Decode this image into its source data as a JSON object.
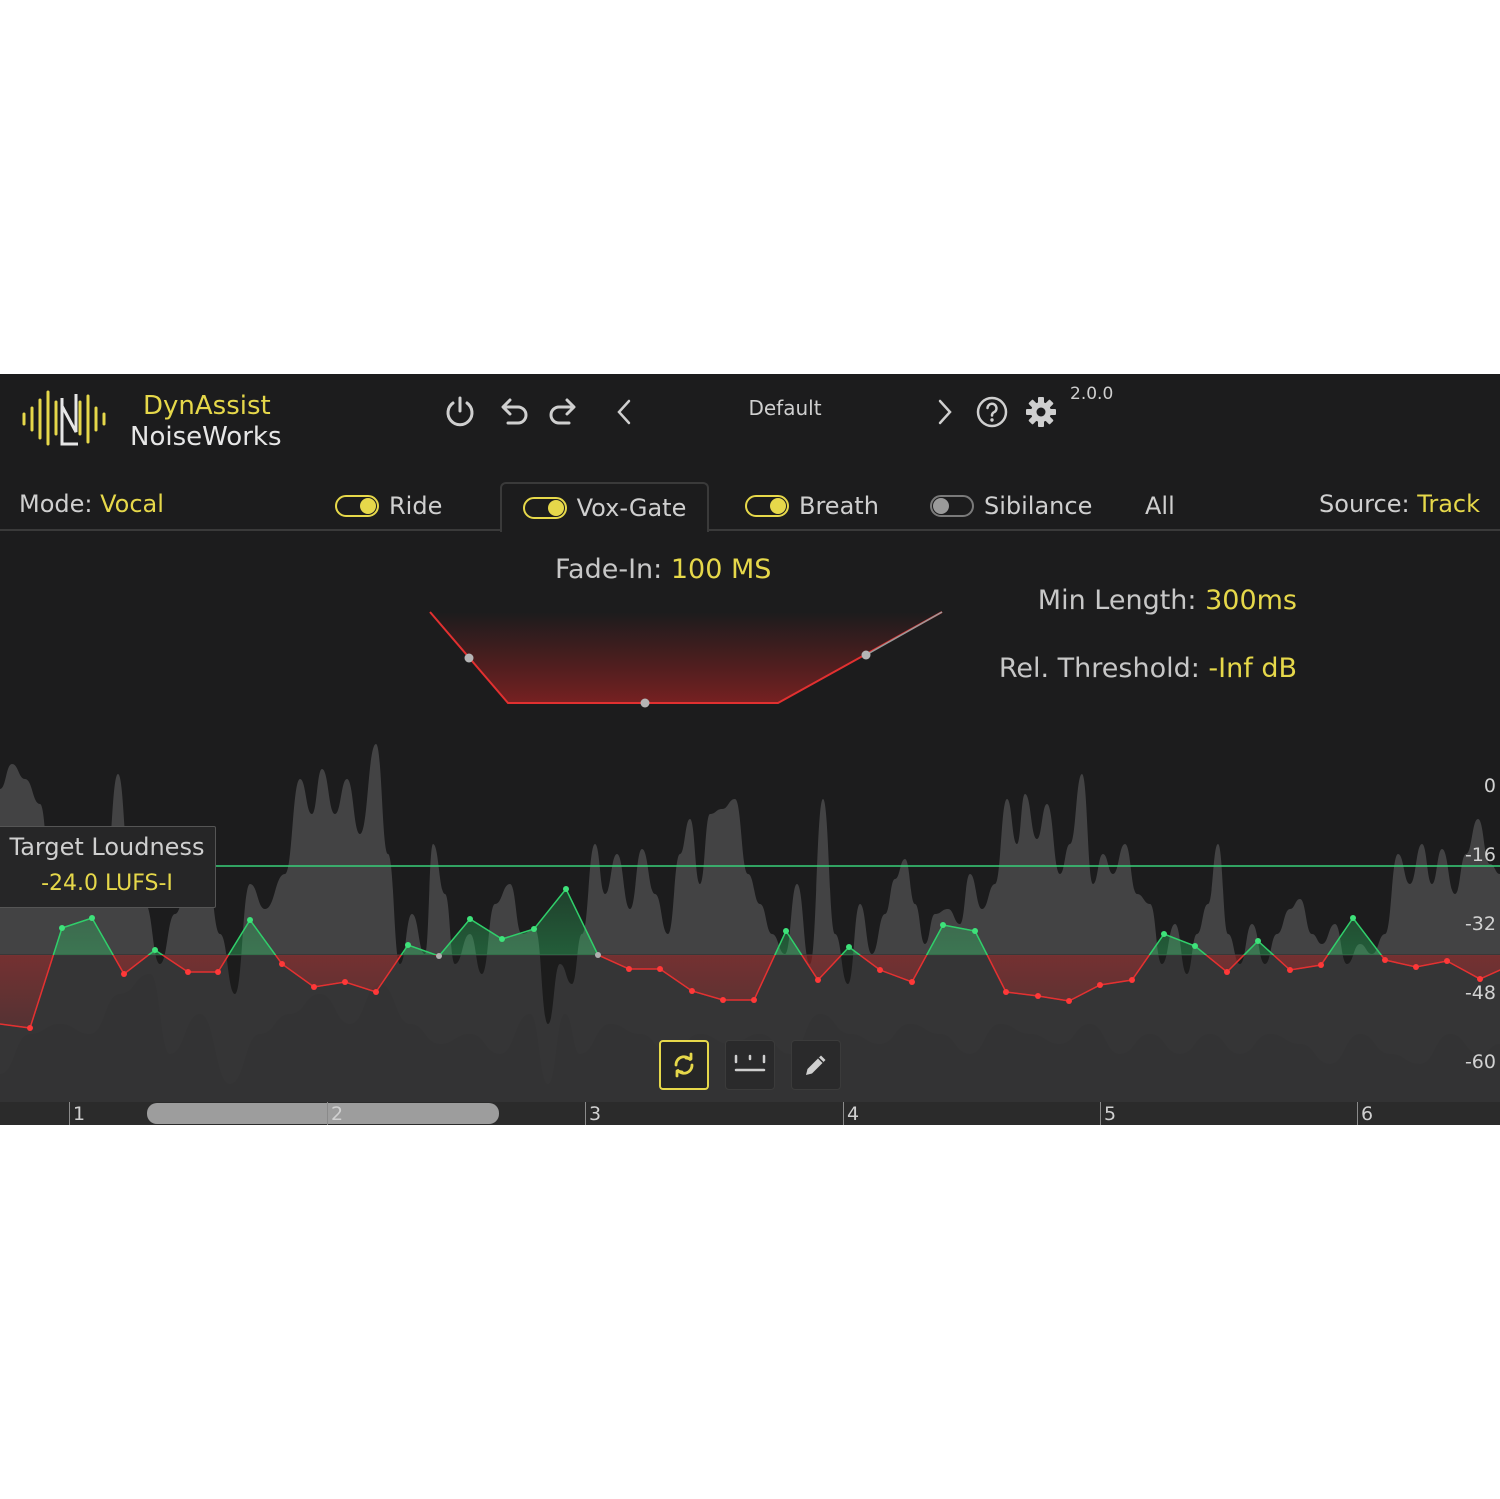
{
  "app": {
    "name": "DynAssist",
    "vendor": "NoiseWorks",
    "version": "2.0.0",
    "preset": "Default"
  },
  "header_icons": [
    "power-icon",
    "undo-icon",
    "redo-icon",
    "prev-preset-icon",
    "next-preset-icon",
    "help-icon",
    "settings-icon"
  ],
  "mode": {
    "label": "Mode:",
    "value": "Vocal"
  },
  "source": {
    "label": "Source:",
    "value": "Track"
  },
  "tabs": [
    {
      "label": "Ride",
      "enabled": true
    },
    {
      "label": "Vox-Gate",
      "enabled": true,
      "selected": true
    },
    {
      "label": "Breath",
      "enabled": true
    },
    {
      "label": "Sibilance",
      "enabled": false
    },
    {
      "label": "All"
    }
  ],
  "gate": {
    "fade_in_label": "Fade-In:",
    "fade_in_value": "100 MS",
    "min_length_label": "Min Length:",
    "min_length_value": "300ms",
    "rel_threshold_label": "Rel. Threshold:",
    "rel_threshold_value": "-Inf dB"
  },
  "target": {
    "label": "Target Loudness",
    "value": "-24.0 LUFS-I"
  },
  "scale_labels": [
    "0",
    "-16",
    "-32",
    "-48",
    "-60"
  ],
  "tools": [
    "loop-icon",
    "snap-icon",
    "pencil-icon"
  ],
  "timeline": {
    "bars": [
      "1",
      "2",
      "3",
      "4",
      "5",
      "6"
    ]
  },
  "colors": {
    "accent": "#e6d84a",
    "boost": "#2fcf6a",
    "cut": "#e53030",
    "background": "#1c1c1d"
  }
}
